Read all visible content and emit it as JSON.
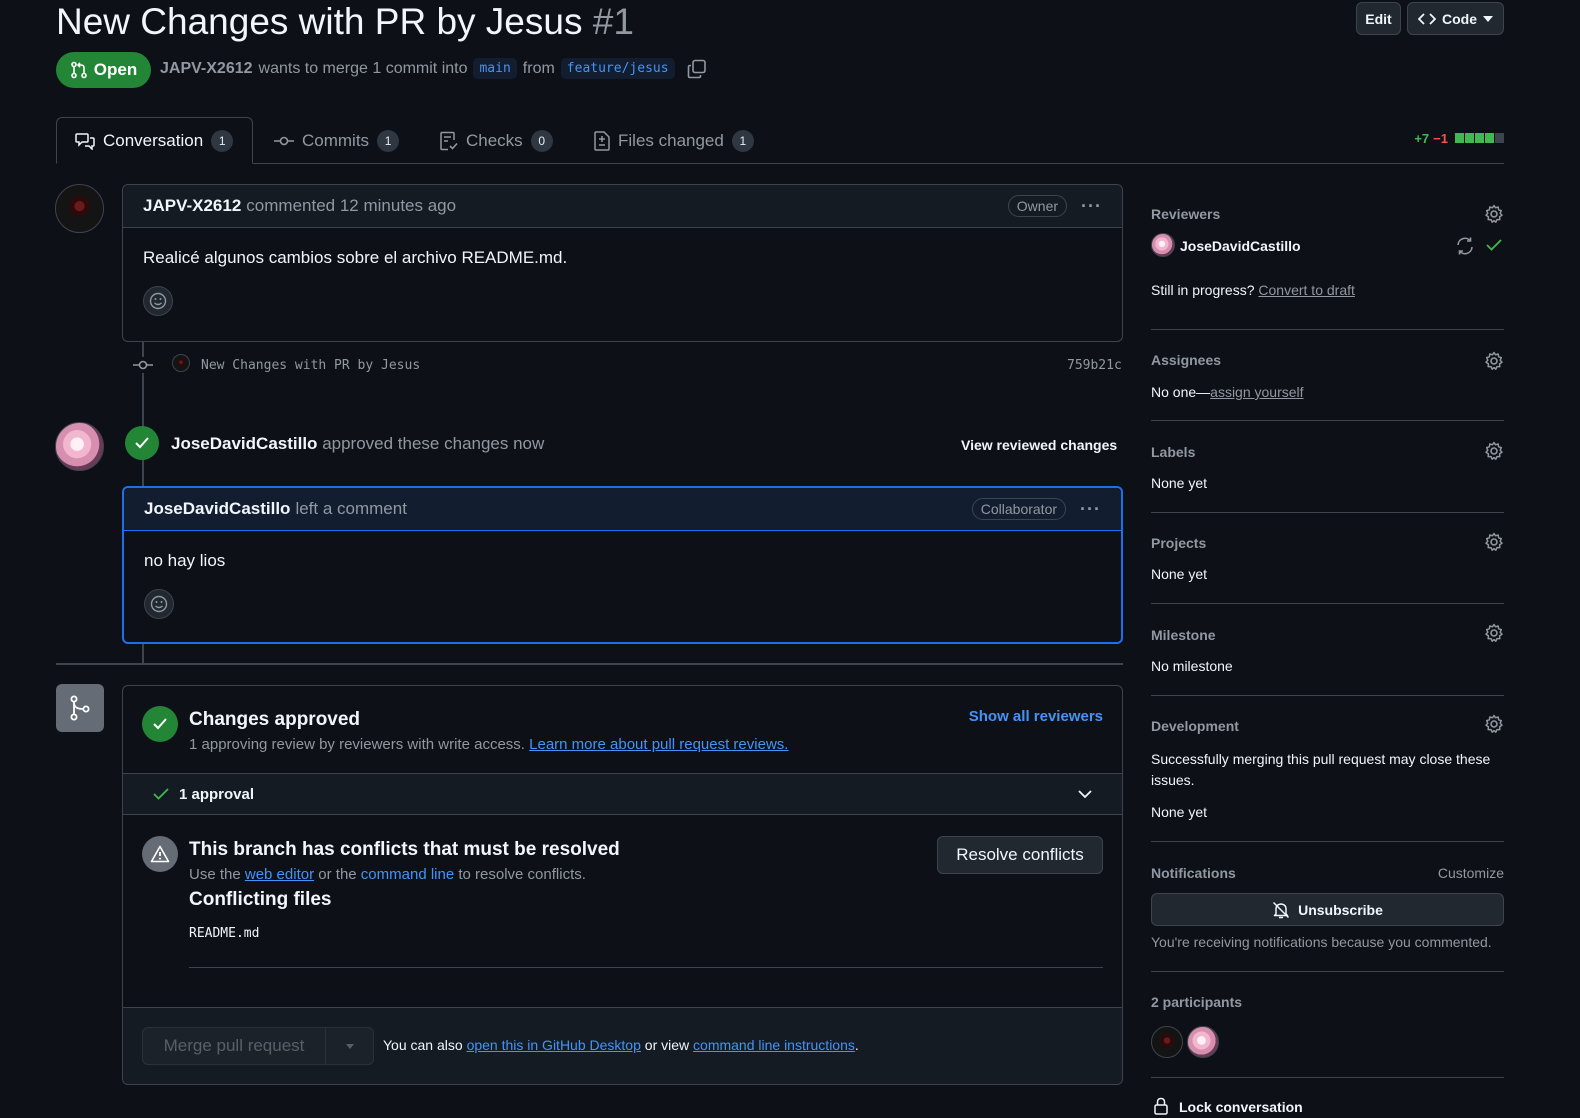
{
  "pr": {
    "title": "New Changes with PR by Jesus",
    "number": "#1",
    "state": "Open",
    "author": "JAPV-X2612",
    "merge_text": "wants to merge 1 commit into",
    "base_branch": "main",
    "from_text": "from",
    "head_branch": "feature/jesus"
  },
  "header_buttons": {
    "edit": "Edit",
    "code": "Code"
  },
  "tabs": [
    {
      "label": "Conversation",
      "count": "1"
    },
    {
      "label": "Commits",
      "count": "1"
    },
    {
      "label": "Checks",
      "count": "0"
    },
    {
      "label": "Files changed",
      "count": "1"
    }
  ],
  "diffstat": {
    "additions": "+7",
    "deletions": "−1",
    "colors": {
      "add": "#3fb950",
      "del": "#f85149",
      "neutral": "#3d444d"
    }
  },
  "first_comment": {
    "author": "JAPV-X2612",
    "action": "commented 12 minutes ago",
    "role": "Owner",
    "body": "Realicé algunos cambios sobre el archivo README.md."
  },
  "commit": {
    "message": "New Changes with PR by Jesus",
    "sha": "759b21c"
  },
  "review": {
    "author": "JoseDavidCastillo",
    "action": "approved these changes now",
    "view_link": "View reviewed changes",
    "comment_author": "JoseDavidCastillo",
    "comment_action": "left a comment",
    "role": "Collaborator",
    "body": "no hay lios"
  },
  "merge": {
    "approved_title": "Changes approved",
    "approved_desc": "1 approving review by reviewers with write access.",
    "approved_link": "Learn more about pull request reviews.",
    "show_reviewers": "Show all reviewers",
    "approval_count": "1 approval",
    "conflict_title": "This branch has conflicts that must be resolved",
    "conflict_desc_1": "Use the",
    "conflict_link_1": "web editor",
    "conflict_desc_2": "or the",
    "conflict_link_2": "command line",
    "conflict_desc_3": "to resolve conflicts.",
    "resolve_button": "Resolve conflicts",
    "conflicting_title": "Conflicting files",
    "conflicting_file": "README.md",
    "merge_button": "Merge pull request",
    "also_text_1": "You can also",
    "also_link_1": "open this in GitHub Desktop",
    "also_text_2": "or view",
    "also_link_2": "command line instructions",
    "also_text_3": "."
  },
  "sidebar": {
    "reviewers": {
      "title": "Reviewers",
      "name": "JoseDavidCastillo",
      "progress_text": "Still in progress?",
      "progress_link": "Convert to draft"
    },
    "assignees": {
      "title": "Assignees",
      "text": "No one—",
      "link": "assign yourself"
    },
    "labels": {
      "title": "Labels",
      "value": "None yet"
    },
    "projects": {
      "title": "Projects",
      "value": "None yet"
    },
    "milestone": {
      "title": "Milestone",
      "value": "No milestone"
    },
    "development": {
      "title": "Development",
      "desc": "Successfully merging this pull request may close these issues.",
      "value": "None yet"
    },
    "notifications": {
      "title": "Notifications",
      "customize": "Customize",
      "button": "Unsubscribe",
      "reason": "You're receiving notifications because you commented."
    },
    "participants": {
      "title": "2 participants"
    },
    "lock": "Lock conversation"
  }
}
